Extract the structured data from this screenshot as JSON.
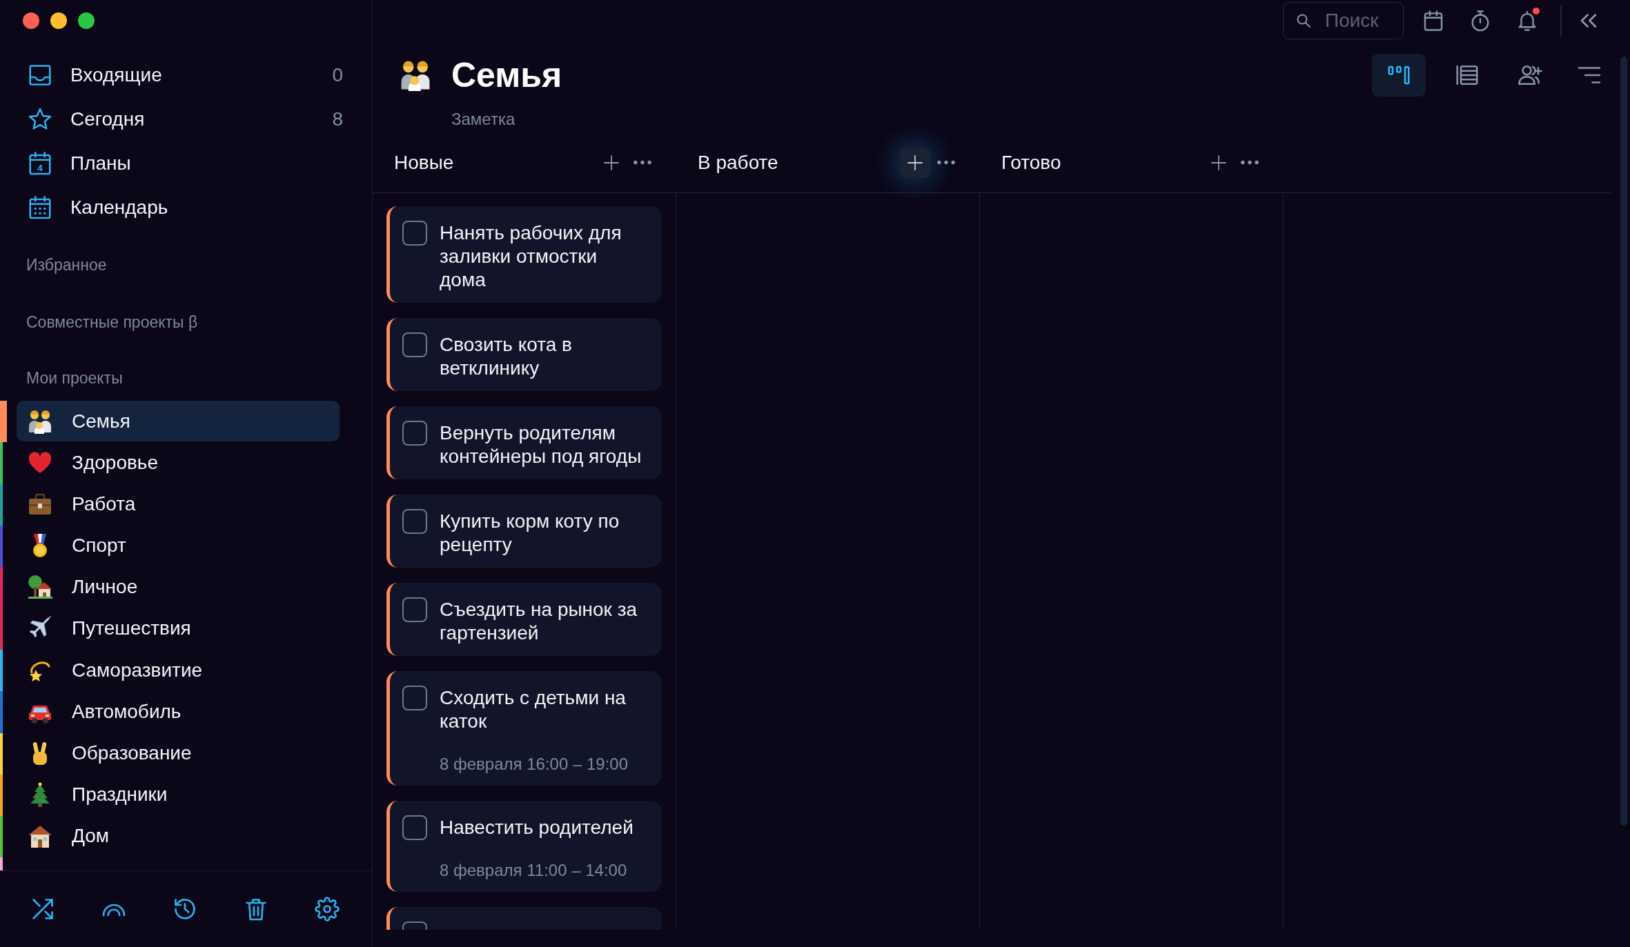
{
  "sidebar": {
    "nav": [
      {
        "label": "Входящие",
        "count": "0",
        "selected": false
      },
      {
        "label": "Сегодня",
        "count": "8",
        "selected": false
      },
      {
        "label": "Планы",
        "icon_digit": "4",
        "selected": false
      },
      {
        "label": "Календарь",
        "selected": false
      }
    ],
    "favorites": {
      "title": "Избранное"
    },
    "shared": {
      "title": "Совместные проекты β"
    },
    "projects": {
      "title": "Мои проекты",
      "items": [
        {
          "name": "Семья",
          "color": "#ff8a5c",
          "selected": true
        },
        {
          "name": "Здоровье",
          "color": "#3cc65a",
          "selected": false
        },
        {
          "name": "Работа",
          "color": "#17a89a",
          "selected": false
        },
        {
          "name": "Спорт",
          "color": "#4f4fcf",
          "selected": false
        },
        {
          "name": "Личное",
          "color": "#e8245e",
          "selected": false
        },
        {
          "name": "Путешествия",
          "color": "#e02a58",
          "selected": false
        },
        {
          "name": "Саморазвитие",
          "color": "#2bb8ec",
          "selected": false
        },
        {
          "name": "Автомобиль",
          "color": "#1e74c8",
          "selected": false
        },
        {
          "name": "Образование",
          "color": "#f5d442",
          "selected": false
        },
        {
          "name": "Праздники",
          "color": "#f5a623",
          "selected": false
        },
        {
          "name": "Дом",
          "color": "#58c43c",
          "selected": false
        },
        {
          "color": "#f2a6dc"
        }
      ]
    }
  },
  "topbar": {
    "search": {
      "placeholder": "Поиск"
    },
    "notifications": {
      "unread": true
    }
  },
  "views": [
    {
      "kind": "board",
      "selected": true
    },
    {
      "kind": "list",
      "selected": false
    }
  ],
  "project": {
    "title": "Семья",
    "description": "Заметка"
  },
  "board": {
    "columns": [
      {
        "title": "Новые",
        "add_focused": false,
        "cards": [
          {
            "title": "Нанять рабочих для заливки отмостки дома",
            "checked": false
          },
          {
            "title": "Свозить кота в ветклинику",
            "checked": false
          },
          {
            "title": "Вернуть родителям контейнеры под ягоды",
            "checked": false
          },
          {
            "title": "Купить корм коту по рецепту",
            "checked": false
          },
          {
            "title": "Съездить на рынок за гартензией",
            "checked": false
          },
          {
            "title": "Сходить с детьми на каток",
            "checked": false,
            "date": "8 февраля 16:00 – 19:00"
          },
          {
            "title": "Навестить родителей",
            "checked": false,
            "date": "8 февраля 11:00 – 14:00"
          },
          {
            "checked": false
          }
        ]
      },
      {
        "title": "В работе",
        "add_focused": true
      },
      {
        "title": "Готово",
        "add_focused": false
      }
    ]
  }
}
